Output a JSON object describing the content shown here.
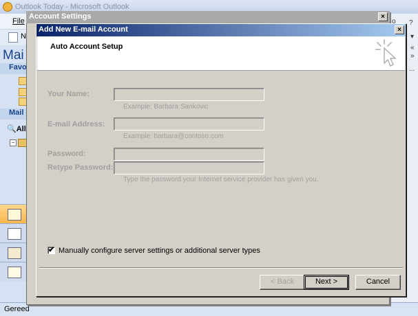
{
  "outlook": {
    "title": "Outlook Today - Microsoft Outlook",
    "menu_file": "File",
    "toolbar_new": "N",
    "nav_mail_header": "Mai",
    "nav_favorites": "Favo",
    "nav_mail_folders": "Mail I",
    "nav_all": "All",
    "tree_toggle": "−",
    "status_text": "Gereed",
    "edge_glyphs": [
      "o",
      "?",
      "▾",
      "«",
      "»",
      "..."
    ]
  },
  "account_settings": {
    "title": "Account Settings",
    "close": "×"
  },
  "dialog": {
    "title": "Add New E-mail Account",
    "close": "×",
    "heading": "Auto Account Setup",
    "your_name_label": "Your Name:",
    "your_name_value": "",
    "your_name_hint": "Example: Barbara Sankovic",
    "email_label": "E-mail Address:",
    "email_value": "",
    "email_hint": "Example: barbara@contoso.com",
    "password_label": "Password:",
    "password_value": "",
    "retype_label": "Retype Password:",
    "retype_value": "",
    "password_hint": "Type the password your Internet service provider has given you.",
    "checkbox_label": "Manually configure server settings or additional server types",
    "checkbox_checked": true,
    "back_label": "< Back",
    "next_label": "Next >",
    "cancel_label": "Cancel"
  },
  "colors": {
    "dialog_title_start": "#0a246a",
    "dialog_title_end": "#a6caf0",
    "disabled_text": "#a0a0a0",
    "outlook_nav": "#d6e2f3",
    "mail_button": "#f7b54a"
  }
}
